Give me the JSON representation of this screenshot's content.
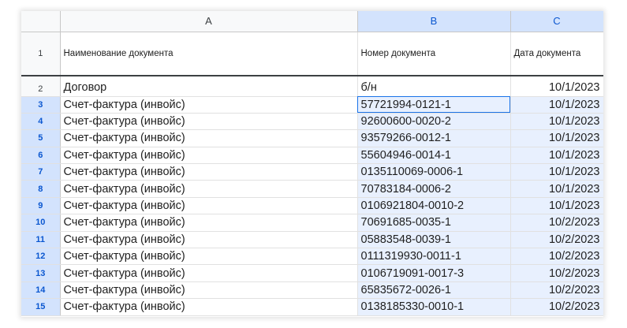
{
  "columns": [
    "A",
    "B",
    "C"
  ],
  "header": {
    "row_number": "1",
    "col_a": "Наименование документа",
    "col_b": "Номер документа",
    "col_c": "Дата документа"
  },
  "rows": [
    {
      "n": "2",
      "a": "Договор",
      "b": "б/н",
      "c": "10/1/2023"
    },
    {
      "n": "3",
      "a": "Счет-фактура (инвойс)",
      "b": "57721994-0121-1",
      "c": "10/1/2023"
    },
    {
      "n": "4",
      "a": "Счет-фактура (инвойс)",
      "b": "92600600-0020-2",
      "c": "10/1/2023"
    },
    {
      "n": "5",
      "a": "Счет-фактура (инвойс)",
      "b": "93579266-0012-1",
      "c": "10/1/2023"
    },
    {
      "n": "6",
      "a": "Счет-фактура (инвойс)",
      "b": "55604946-0014-1",
      "c": "10/1/2023"
    },
    {
      "n": "7",
      "a": "Счет-фактура (инвойс)",
      "b": "0135110069-0006-1",
      "c": "10/1/2023"
    },
    {
      "n": "8",
      "a": "Счет-фактура (инвойс)",
      "b": "70783184-0006-2",
      "c": "10/1/2023"
    },
    {
      "n": "9",
      "a": "Счет-фактура (инвойс)",
      "b": "0106921804-0010-2",
      "c": "10/1/2023"
    },
    {
      "n": "10",
      "a": "Счет-фактура (инвойс)",
      "b": "70691685-0035-1",
      "c": "10/2/2023"
    },
    {
      "n": "11",
      "a": "Счет-фактура (инвойс)",
      "b": "05883548-0039-1",
      "c": "10/2/2023"
    },
    {
      "n": "12",
      "a": "Счет-фактура (инвойс)",
      "b": "0111319930-0011-1",
      "c": "10/2/2023"
    },
    {
      "n": "13",
      "a": "Счет-фактура (инвойс)",
      "b": "0106719091-0017-3",
      "c": "10/2/2023"
    },
    {
      "n": "14",
      "a": "Счет-фактура (инвойс)",
      "b": "65835672-0026-1",
      "c": "10/2/2023"
    },
    {
      "n": "15",
      "a": "Счет-фактура (инвойс)",
      "b": "0138185330-0010-1",
      "c": "10/2/2023"
    }
  ],
  "selection": {
    "columns": [
      "B",
      "C"
    ],
    "rows_from": "3",
    "rows_to": "15",
    "active_cell": "B3"
  },
  "colors": {
    "selection_fill": "#e8f0fe",
    "selected_header_fill": "#d3e3fd",
    "selected_header_text": "#0b57d0",
    "active_border": "#1a73e8"
  }
}
